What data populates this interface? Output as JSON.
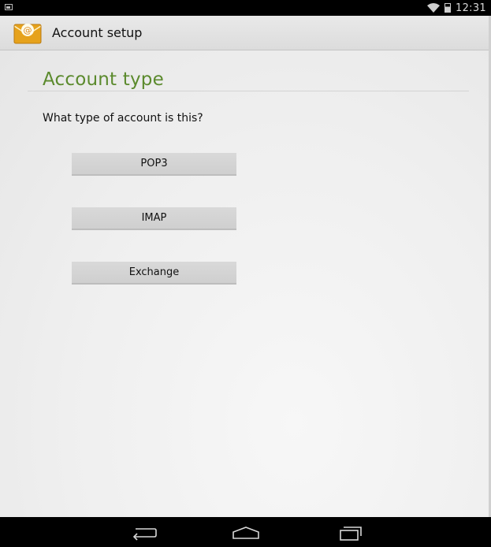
{
  "status_bar": {
    "time": "12:31",
    "left_icon": "notification-image-icon",
    "wifi_icon": "wifi-icon",
    "battery_icon": "battery-icon"
  },
  "action_bar": {
    "app_icon": "email-app-icon",
    "title": "Account setup"
  },
  "main": {
    "section_title": "Account type",
    "question": "What type of account is this?",
    "buttons": [
      {
        "label": "POP3"
      },
      {
        "label": "IMAP"
      },
      {
        "label": "Exchange"
      }
    ]
  },
  "nav_bar": {
    "back_icon": "back-icon",
    "home_icon": "home-icon",
    "recents_icon": "recent-apps-icon"
  },
  "colors": {
    "accent": "#5b8a2d",
    "status_bar_bg": "#000000",
    "button_bg": "#d4d4d4"
  }
}
